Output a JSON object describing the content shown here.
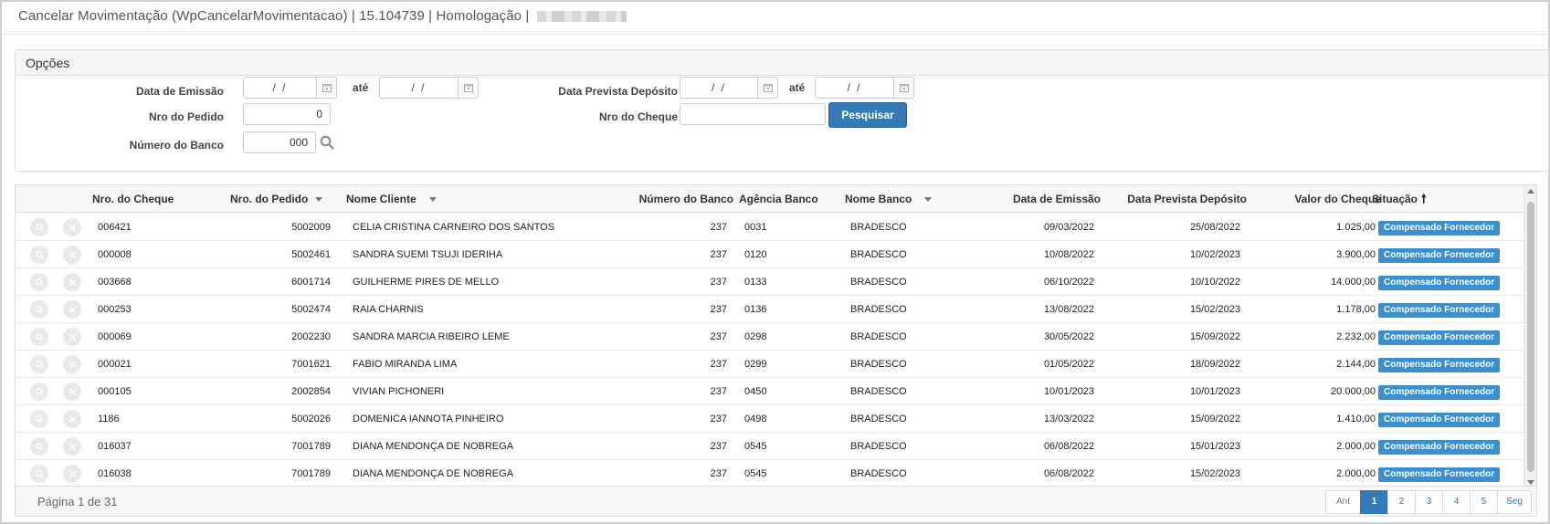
{
  "header": {
    "title": "Cancelar Movimentação (WpCancelarMovimentacao) | 15.104739 | Homologação | "
  },
  "options": {
    "panel_title": "Opções",
    "data_emissao_label": "Data de Emissão",
    "ate_label": "até",
    "data_prevista_label": "Data Prevista Depósito",
    "ate2_label": "até",
    "nro_pedido_label": "Nro do Pedido",
    "nro_cheque_label": "Nro do Cheque",
    "numero_banco_label": "Número do Banco",
    "date_placeholder": "/ /",
    "nro_pedido_value": "0",
    "nro_cheque_value": "",
    "numero_banco_value": "000",
    "search_button": "Pesquisar"
  },
  "grid": {
    "columns": [
      "Nro. do Cheque",
      "Nro. do Pedido",
      "Nome Cliente",
      "Número do Banco",
      "Agência Banco",
      "Nome Banco",
      "Data de Emissão",
      "Data Prevista Depósito",
      "Valor do Cheque",
      "Situação"
    ],
    "rows": [
      {
        "cheque": "006421",
        "pedido": "5002009",
        "cliente": "CELIA CRISTINA CARNEIRO DOS SANTOS",
        "banco": "237",
        "agencia": "0031",
        "nome_banco": "BRADESCO",
        "emissao": "09/03/2022",
        "prevista": "25/08/2022",
        "valor": "1.025,00",
        "situacao": "Compensado Fornecedor"
      },
      {
        "cheque": "000008",
        "pedido": "5002461",
        "cliente": "SANDRA SUEMI TSUJI IDERIHA",
        "banco": "237",
        "agencia": "0120",
        "nome_banco": "BRADESCO",
        "emissao": "10/08/2022",
        "prevista": "10/02/2023",
        "valor": "3.900,00",
        "situacao": "Compensado Fornecedor"
      },
      {
        "cheque": "003668",
        "pedido": "6001714",
        "cliente": "GUILHERME PIRES DE MELLO",
        "banco": "237",
        "agencia": "0133",
        "nome_banco": "BRADESCO",
        "emissao": "06/10/2022",
        "prevista": "10/10/2022",
        "valor": "14.000,00",
        "situacao": "Compensado Fornecedor"
      },
      {
        "cheque": "000253",
        "pedido": "5002474",
        "cliente": "RAIA CHARNIS",
        "banco": "237",
        "agencia": "0136",
        "nome_banco": "BRADESCO",
        "emissao": "13/08/2022",
        "prevista": "15/02/2023",
        "valor": "1.178,00",
        "situacao": "Compensado Fornecedor"
      },
      {
        "cheque": "000069",
        "pedido": "2002230",
        "cliente": "SANDRA MARCIA RIBEIRO LEME",
        "banco": "237",
        "agencia": "0298",
        "nome_banco": "BRADESCO",
        "emissao": "30/05/2022",
        "prevista": "15/09/2022",
        "valor": "2.232,00",
        "situacao": "Compensado Fornecedor"
      },
      {
        "cheque": "000021",
        "pedido": "7001621",
        "cliente": "FABIO MIRANDA LIMA",
        "banco": "237",
        "agencia": "0299",
        "nome_banco": "BRADESCO",
        "emissao": "01/05/2022",
        "prevista": "18/09/2022",
        "valor": "2.144,00",
        "situacao": "Compensado Fornecedor"
      },
      {
        "cheque": "000105",
        "pedido": "2002854",
        "cliente": "VIVIAN PICHONERI",
        "banco": "237",
        "agencia": "0450",
        "nome_banco": "BRADESCO",
        "emissao": "10/01/2023",
        "prevista": "10/01/2023",
        "valor": "20.000,00",
        "situacao": "Compensado Fornecedor"
      },
      {
        "cheque": "1186",
        "pedido": "5002026",
        "cliente": "DOMENICA IANNOTA PINHEIRO",
        "banco": "237",
        "agencia": "0498",
        "nome_banco": "BRADESCO",
        "emissao": "13/03/2022",
        "prevista": "15/09/2022",
        "valor": "1.410,00",
        "situacao": "Compensado Fornecedor"
      },
      {
        "cheque": "016037",
        "pedido": "7001789",
        "cliente": "DIANA MENDONÇA DE NOBREGA",
        "banco": "237",
        "agencia": "0545",
        "nome_banco": "BRADESCO",
        "emissao": "06/08/2022",
        "prevista": "15/01/2023",
        "valor": "2.000,00",
        "situacao": "Compensado Fornecedor"
      },
      {
        "cheque": "016038",
        "pedido": "7001789",
        "cliente": "DIANA MENDONÇA DE NOBREGA",
        "banco": "237",
        "agencia": "0545",
        "nome_banco": "BRADESCO",
        "emissao": "06/08/2022",
        "prevista": "15/02/2023",
        "valor": "2.000,00",
        "situacao": "Compensado Fornecedor"
      }
    ],
    "page_info": "Página 1 de 31",
    "pager": {
      "prev": "Ant",
      "pages": [
        "1",
        "2",
        "3",
        "4",
        "5"
      ],
      "next": "Seg"
    }
  },
  "colors": {
    "primary": "#337ab7",
    "badge": "#3a8fd0"
  },
  "icons": {
    "search": "search-icon",
    "calendar": "calendar-icon",
    "view": "magnifier-icon",
    "cancel": "close-icon",
    "sort_up": "arrow-up-icon"
  }
}
